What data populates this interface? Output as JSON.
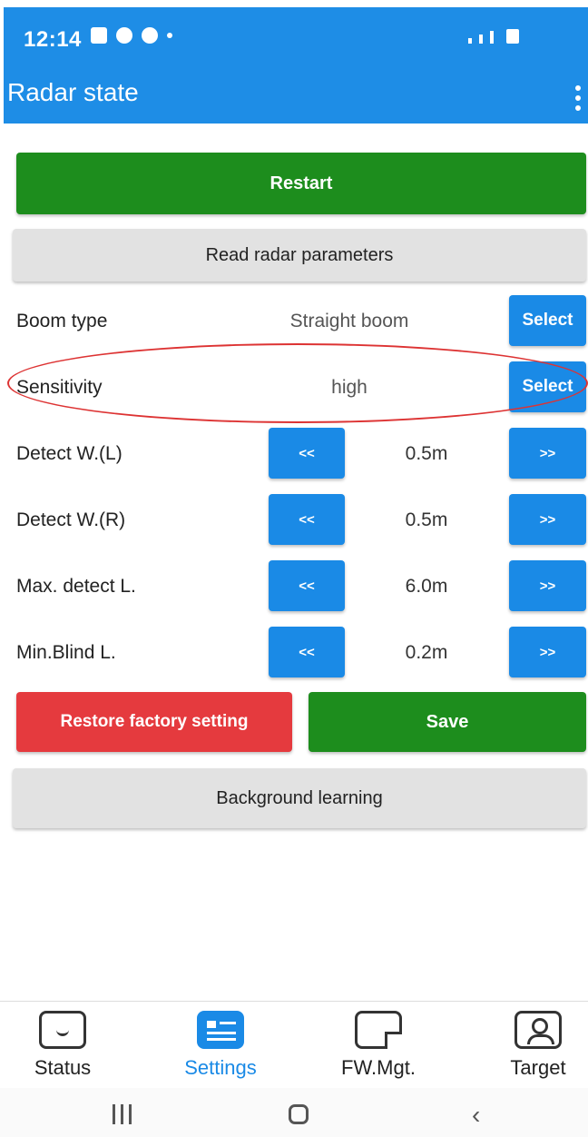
{
  "status_bar": {
    "time": "12:14"
  },
  "app_bar": {
    "title": "Radar state"
  },
  "actions": {
    "restart": "Restart",
    "read_params": "Read radar parameters",
    "restore": "Restore factory setting",
    "save": "Save",
    "background_learning": "Background learning"
  },
  "rows": {
    "boom": {
      "label": "Boom type",
      "value": "Straight boom",
      "button": "Select"
    },
    "sensitivity": {
      "label": "Sensitivity",
      "value": "high",
      "button": "Select"
    },
    "detect_l": {
      "label": "Detect W.(L)",
      "value": "0.5m",
      "dec": "<<",
      "inc": ">>"
    },
    "detect_r": {
      "label": "Detect W.(R)",
      "value": "0.5m",
      "dec": "<<",
      "inc": ">>"
    },
    "max_detect": {
      "label": "Max. detect L.",
      "value": "6.0m",
      "dec": "<<",
      "inc": ">>"
    },
    "min_blind": {
      "label": "Min.Blind L.",
      "value": "0.2m",
      "dec": "<<",
      "inc": ">>"
    }
  },
  "bottom_nav": {
    "items": [
      {
        "label": "Status",
        "icon": "message-icon"
      },
      {
        "label": "Settings",
        "icon": "settings-card-icon",
        "active": true
      },
      {
        "label": "FW.Mgt.",
        "icon": "document-icon"
      },
      {
        "label": "Target",
        "icon": "person-icon"
      }
    ]
  },
  "colors": {
    "primary": "#1e8de6",
    "green": "#1d8d1d",
    "red": "#e53a3e",
    "highlight": "#dd3333"
  }
}
